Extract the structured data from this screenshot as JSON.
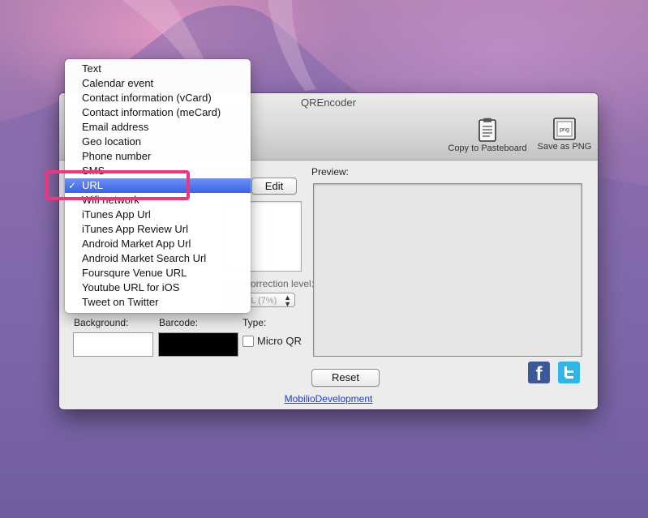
{
  "window": {
    "title": "QREncoder",
    "toolbar": {
      "copy_label": "Copy to Pasteboard",
      "png_label": "Save as PNG",
      "png_icon_text": "png"
    },
    "edit_label": "Edit",
    "preview_label": "Preview:",
    "error_correction_label": "Error correction level:",
    "error_correction_value": "Level L (7%)",
    "background_label": "Background:",
    "barcode_label": "Barcode:",
    "type_label": "Type:",
    "micro_qr_label": "Micro QR",
    "reset_label": "Reset",
    "link_label": "MobilioDevelopment",
    "colors": {
      "background": "#ffffff",
      "barcode": "#000000"
    }
  },
  "menu": {
    "items": [
      "Text",
      "Calendar event",
      "Contact information (vCard)",
      "Contact information (meCard)",
      "Email address",
      "Geo location",
      "Phone number",
      "SMS",
      "URL",
      "Wifi network",
      "iTunes App Url",
      "iTunes App Review Url",
      "Android Market App Url",
      "Android Market Search Url",
      "Foursqure Venue URL",
      "Youtube URL for iOS",
      "Tweet on Twitter"
    ],
    "selected": "URL",
    "checkmark": "✓"
  },
  "social": {
    "facebook": "f"
  },
  "accent": {
    "selection": "#3765e8",
    "highlight": "#f0357a"
  }
}
